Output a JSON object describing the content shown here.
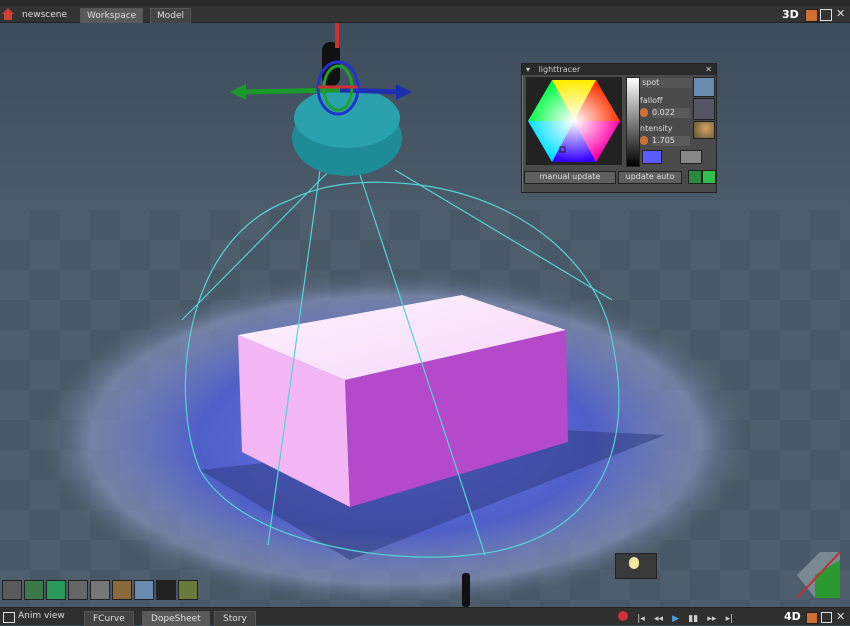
{
  "top_tabs": [
    {
      "label": "newscene"
    },
    {
      "label": "Workspace"
    },
    {
      "label": "Model"
    }
  ],
  "view_mode": "3D",
  "light_panel": {
    "title": "lighttracer",
    "type": "spot",
    "falloff_label": "falloff",
    "falloff_value": "0.022",
    "intensity_label": "ntensity",
    "intensity_value": "1.705",
    "manual_update": "manual update",
    "update_auto": "update auto"
  },
  "bottom_panel": {
    "title": "Anim view",
    "tabs": [
      {
        "label": "FCurve"
      },
      {
        "label": "DopeSheet"
      },
      {
        "label": "Story"
      }
    ],
    "mode": "4D"
  },
  "colors": {
    "box": "#e9a6f0",
    "light_cone": "#53d4d4",
    "floor_glow": "#4b5ee0",
    "accent": "#d07030"
  }
}
